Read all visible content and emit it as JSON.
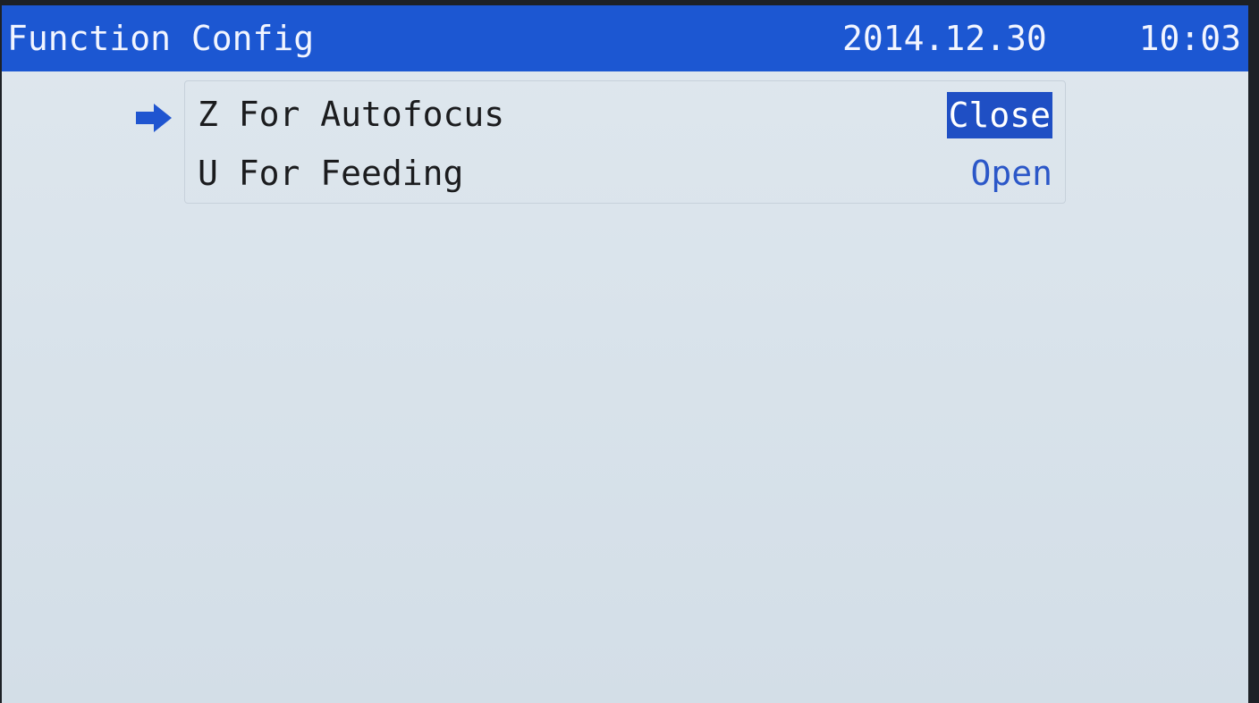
{
  "header": {
    "title": "Function Config",
    "date": "2014.12.30",
    "time": "10:03"
  },
  "menu": {
    "items": [
      {
        "label": "Z For Autofocus",
        "value": "Close",
        "selected": true
      },
      {
        "label": "U For Feeding",
        "value": "Open",
        "selected": false
      }
    ]
  },
  "icons": {
    "cursor": "arrow-right-icon"
  },
  "colors": {
    "title_bar": "#1c57d2",
    "selection_highlight": "#1f4fc4",
    "value_text": "#2b57c8",
    "background": "#dbe4ec"
  }
}
